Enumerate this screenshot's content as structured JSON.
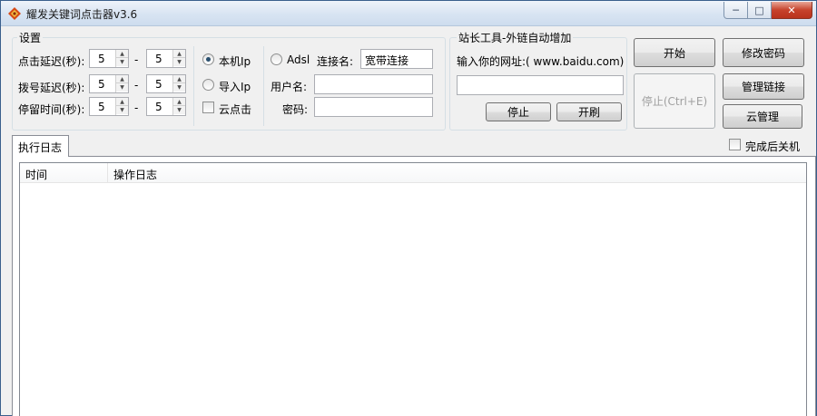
{
  "window": {
    "title": "耀发关键词点击器v3.6",
    "controls": {
      "minimize": "─",
      "maximize": "□",
      "close": "✕"
    }
  },
  "settings": {
    "legend": "设置",
    "rows": [
      {
        "label": "点击延迟(秒):",
        "from": "5",
        "to": "5"
      },
      {
        "label": "拨号延迟(秒):",
        "from": "5",
        "to": "5"
      },
      {
        "label": "停留时间(秒):",
        "from": "5",
        "to": "5"
      }
    ],
    "range_separator": "-",
    "ip_options": [
      {
        "label": "本机Ip",
        "checked": true
      },
      {
        "label": "导入Ip",
        "checked": false
      }
    ],
    "cloud_click": {
      "label": "云点击",
      "checked": false
    },
    "adsl": {
      "label": "Adsl",
      "checked": false,
      "connection_label": "连接名:",
      "connection_value": "宽带连接",
      "username_label": "用户名:",
      "username_value": "",
      "password_label": "密码:",
      "password_value": ""
    }
  },
  "webmaster": {
    "legend": "站长工具-外链自动增加",
    "url_prompt": "输入你的网址:( www.baidu.com)",
    "url_value": "",
    "stop_label": "停止",
    "start_label": "开刷"
  },
  "actions": {
    "start": "开始",
    "change_password": "修改密码",
    "stop": "停止(Ctrl+E)",
    "manage_links": "管理链接",
    "cloud_manage": "云管理"
  },
  "log": {
    "tab_label": "执行日志",
    "shutdown_label": "完成后关机",
    "shutdown_checked": false,
    "columns": [
      "时间",
      "操作日志"
    ],
    "rows": []
  },
  "colors": {
    "window_bg": "#f0f0f0",
    "titlebar": "#d8e4f2",
    "close_button": "#c7432c"
  },
  "icons": {
    "app": "app-logo-icon",
    "spin_up": "spin-up-arrow-icon",
    "spin_down": "spin-down-arrow-icon"
  }
}
